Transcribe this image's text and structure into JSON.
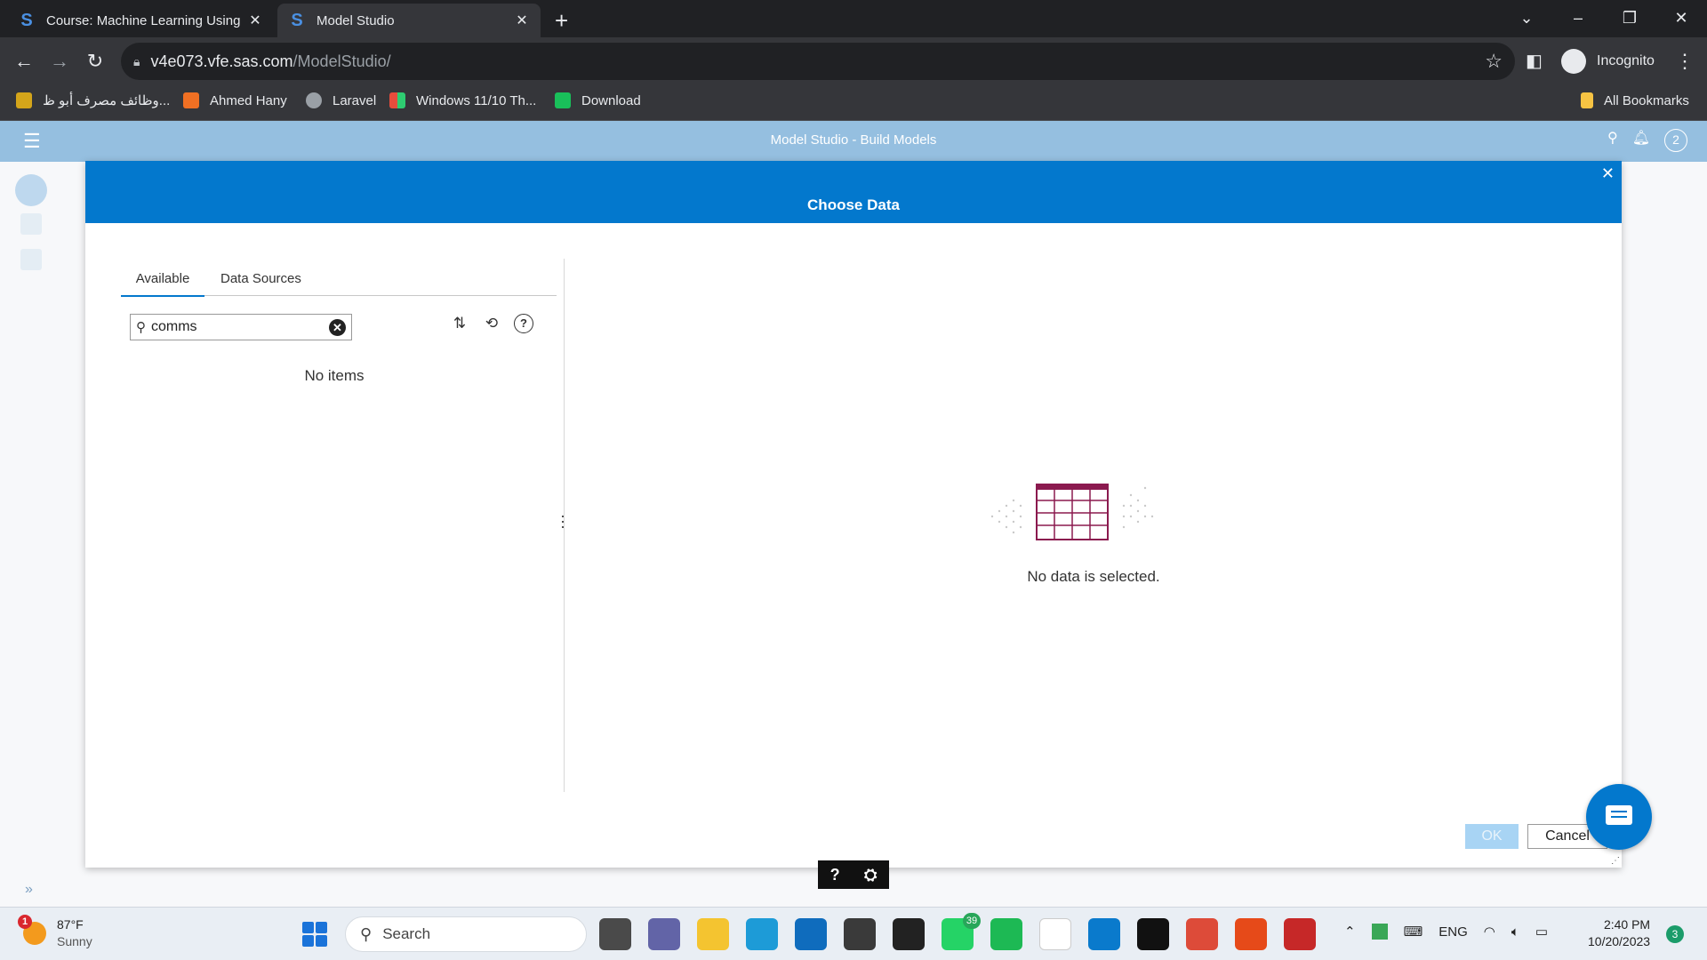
{
  "browser": {
    "tabs": [
      {
        "title": "Course: Machine Learning Using",
        "active": false
      },
      {
        "title": "Model Studio",
        "active": true
      }
    ],
    "address": {
      "domain": "v4e073.vfe.sas.com",
      "path": "/ModelStudio/"
    },
    "profile_label": "Incognito",
    "bookmarks": [
      {
        "label": "وظائف مصرف أبو ظ...",
        "icon": "bank-icon",
        "color": "#d4a51a"
      },
      {
        "label": "Ahmed Hany",
        "icon": "codepen-icon",
        "color": "#f07023"
      },
      {
        "label": "Laravel",
        "icon": "globe-icon",
        "color": "#9aa0a6"
      },
      {
        "label": "Windows 11/10 Th...",
        "icon": "windows-icon",
        "color": "#3c78d8"
      },
      {
        "label": "Download",
        "icon": "download-site-icon",
        "color": "#19c05a"
      }
    ],
    "all_bookmarks_label": "All Bookmarks"
  },
  "app": {
    "title": "Model Studio - Build Models",
    "notification_count": "2"
  },
  "dialog": {
    "title": "Choose Data",
    "tabs": [
      "Available",
      "Data Sources"
    ],
    "search_value": "comms",
    "no_items_text": "No items",
    "no_data_text": "No data is selected.",
    "ok_label": "OK",
    "cancel_label": "Cancel"
  },
  "helpbar": {
    "help_label": "?"
  },
  "taskbar": {
    "weather": {
      "temp": "87°F",
      "condition": "Sunny",
      "alert_count": "1"
    },
    "search_label": "Search",
    "apps": [
      {
        "name": "task-view-app",
        "color": "#4a4a4a"
      },
      {
        "name": "teams-meet-app",
        "color": "#6264a7"
      },
      {
        "name": "file-explorer-app",
        "color": "#f4c430"
      },
      {
        "name": "edge-app",
        "color": "#1d9bd7"
      },
      {
        "name": "mail-app",
        "color": "#0f6cbd"
      },
      {
        "name": "unity-app",
        "color": "#3a3a3a"
      },
      {
        "name": "epic-games-app",
        "color": "#222222"
      },
      {
        "name": "whatsapp-app",
        "color": "#25d366",
        "badge": "39"
      },
      {
        "name": "spotify-app",
        "color": "#1db954"
      },
      {
        "name": "word-app",
        "color": "#ffffff"
      },
      {
        "name": "vscode-app",
        "color": "#0a7acc"
      },
      {
        "name": "mm-app",
        "color": "#111111"
      },
      {
        "name": "chrome-app",
        "color": "#dd4b39"
      },
      {
        "name": "office-app",
        "color": "#e64a19"
      },
      {
        "name": "chrome-incognito-app",
        "color": "#c62828"
      }
    ],
    "language": "ENG",
    "time": "2:40 PM",
    "date": "10/20/2023",
    "notification_count": "3"
  }
}
